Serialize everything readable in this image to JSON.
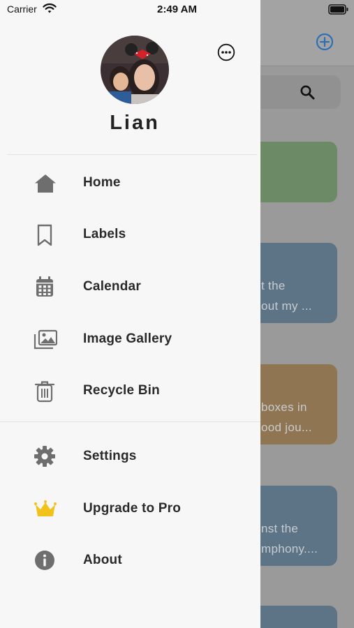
{
  "status_bar": {
    "carrier": "Carrier",
    "time": "2:49 AM"
  },
  "profile": {
    "name": "Lian"
  },
  "menu": {
    "primary": [
      {
        "label": "Home",
        "icon": "home-icon"
      },
      {
        "label": "Labels",
        "icon": "bookmark-icon"
      },
      {
        "label": "Calendar",
        "icon": "calendar-icon"
      },
      {
        "label": "Image Gallery",
        "icon": "image-gallery-icon"
      },
      {
        "label": "Recycle Bin",
        "icon": "trash-icon"
      }
    ],
    "secondary": [
      {
        "label": "Settings",
        "icon": "gear-icon"
      },
      {
        "label": "Upgrade to Pro",
        "icon": "crown-icon"
      },
      {
        "label": "About",
        "icon": "info-icon"
      }
    ]
  },
  "background_cards": [
    {
      "lines": [
        "",
        ""
      ],
      "color": "#6c8a66"
    },
    {
      "lines": [
        "t the",
        "out my ..."
      ],
      "color": "#5d7487"
    },
    {
      "lines": [
        "boxes in",
        "ood jou..."
      ],
      "color": "#8f7552"
    },
    {
      "lines": [
        "nst the",
        "mphony...."
      ],
      "color": "#5d7487"
    },
    {
      "lines": [
        "",
        ""
      ],
      "color": "#5d7487"
    }
  ],
  "colors": {
    "accent": "#2c6fb5",
    "drawer_bg": "#f7f7f7",
    "icon_gray": "#6e6e6e",
    "crown": "#f1c21b"
  }
}
